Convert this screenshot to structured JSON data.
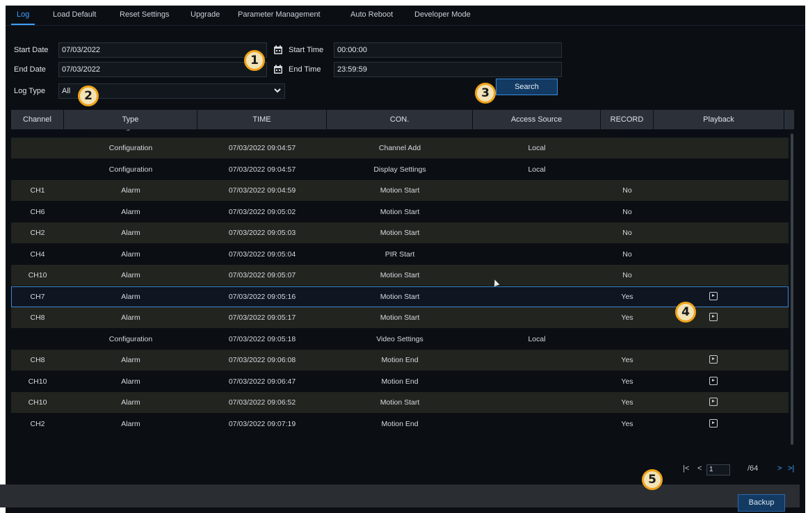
{
  "tabs": [
    "Log",
    "Load Default",
    "Reset Settings",
    "Upgrade",
    "Parameter Management",
    "Auto Reboot",
    "Developer Mode"
  ],
  "form": {
    "start_date_label": "Start Date",
    "start_date_value": "07/03/2022",
    "end_date_label": "End Date",
    "end_date_value": "07/03/2022",
    "start_time_label": "Start Time",
    "start_time_value": "00:00:00",
    "end_time_label": "End Time",
    "end_time_value": "23:59:59",
    "log_type_label": "Log Type",
    "log_type_value": "All",
    "search_label": "Search"
  },
  "table": {
    "headers": [
      "Channel",
      "Type",
      "TIME",
      "CON.",
      "Access Source",
      "RECORD",
      "Playback"
    ],
    "partial_row": {
      "type": "Configuration",
      "time": "07/03/2022 09:04:57",
      "con": "Channel Add",
      "source": "Local"
    },
    "rows": [
      {
        "channel": "",
        "type": "Configuration",
        "time": "07/03/2022 09:04:57",
        "con": "Channel Add",
        "source": "Local",
        "record": "",
        "playback": false
      },
      {
        "channel": "",
        "type": "Configuration",
        "time": "07/03/2022 09:04:57",
        "con": "Display Settings",
        "source": "Local",
        "record": "",
        "playback": false
      },
      {
        "channel": "CH1",
        "type": "Alarm",
        "time": "07/03/2022 09:04:59",
        "con": "Motion Start",
        "source": "",
        "record": "No",
        "playback": false
      },
      {
        "channel": "CH6",
        "type": "Alarm",
        "time": "07/03/2022 09:05:02",
        "con": "Motion Start",
        "source": "",
        "record": "No",
        "playback": false
      },
      {
        "channel": "CH2",
        "type": "Alarm",
        "time": "07/03/2022 09:05:03",
        "con": "Motion Start",
        "source": "",
        "record": "No",
        "playback": false
      },
      {
        "channel": "CH4",
        "type": "Alarm",
        "time": "07/03/2022 09:05:04",
        "con": "PIR Start",
        "source": "",
        "record": "No",
        "playback": false
      },
      {
        "channel": "CH10",
        "type": "Alarm",
        "time": "07/03/2022 09:05:07",
        "con": "Motion Start",
        "source": "",
        "record": "No",
        "playback": false
      },
      {
        "channel": "CH7",
        "type": "Alarm",
        "time": "07/03/2022 09:05:16",
        "con": "Motion Start",
        "source": "",
        "record": "Yes",
        "playback": true,
        "selected": true
      },
      {
        "channel": "CH8",
        "type": "Alarm",
        "time": "07/03/2022 09:05:17",
        "con": "Motion Start",
        "source": "",
        "record": "Yes",
        "playback": true
      },
      {
        "channel": "",
        "type": "Configuration",
        "time": "07/03/2022 09:05:18",
        "con": "Video Settings",
        "source": "Local",
        "record": "",
        "playback": false
      },
      {
        "channel": "CH8",
        "type": "Alarm",
        "time": "07/03/2022 09:06:08",
        "con": "Motion End",
        "source": "",
        "record": "Yes",
        "playback": true
      },
      {
        "channel": "CH10",
        "type": "Alarm",
        "time": "07/03/2022 09:06:47",
        "con": "Motion End",
        "source": "",
        "record": "Yes",
        "playback": true
      },
      {
        "channel": "CH10",
        "type": "Alarm",
        "time": "07/03/2022 09:06:52",
        "con": "Motion Start",
        "source": "",
        "record": "Yes",
        "playback": true
      },
      {
        "channel": "CH2",
        "type": "Alarm",
        "time": "07/03/2022 09:07:19",
        "con": "Motion End",
        "source": "",
        "record": "Yes",
        "playback": true
      }
    ]
  },
  "pager": {
    "current_page": "1",
    "total": "/64"
  },
  "backup_label": "Backup",
  "callouts": [
    "1",
    "2",
    "3",
    "4",
    "5"
  ],
  "colors": {
    "accent": "#3fa0ff",
    "callout_border": "#f0a31a",
    "callout_fill": "#f2e3b6",
    "button_bg": "#123a63"
  }
}
